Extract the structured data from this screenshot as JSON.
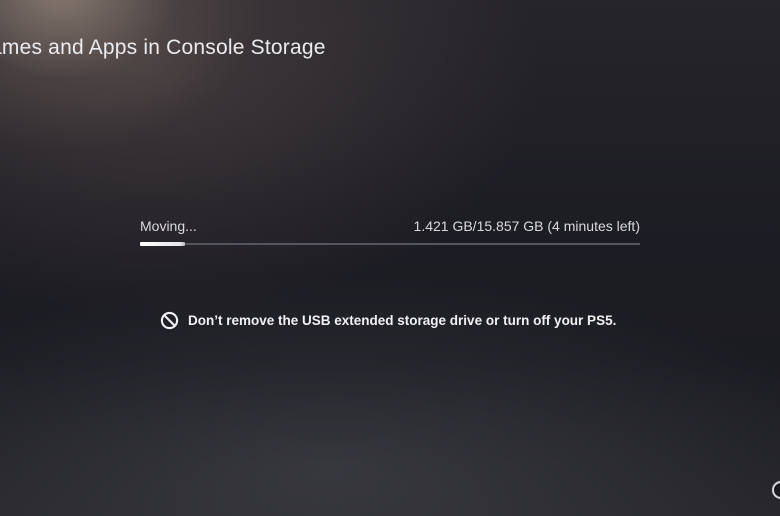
{
  "page": {
    "title": "ames and Apps in Console Storage"
  },
  "progress": {
    "status_label": "Moving...",
    "amount_text": "1.421 GB/15.857 GB (4 minutes left)",
    "fraction": 0.0896
  },
  "warning": {
    "icon": "prohibited-icon",
    "text": "Don’t remove the USB extended storage drive or turn off your PS5."
  },
  "colors": {
    "background": "#1b1b22",
    "text": "#e9e9ee",
    "progress_fill": "#ffffff",
    "progress_track": "#55555d"
  }
}
